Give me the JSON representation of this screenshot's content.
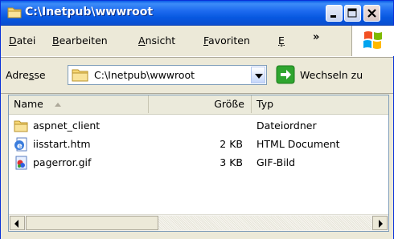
{
  "window": {
    "title": "C:\\Inetpub\\wwwroot",
    "controls": [
      "minimize",
      "maximize",
      "close"
    ]
  },
  "menu": {
    "items": [
      {
        "label": "Datei",
        "mnemonic": "D",
        "rest": "atei"
      },
      {
        "label": "Bearbeiten",
        "mnemonic": "B",
        "rest": "earbeiten"
      },
      {
        "label": "Ansicht",
        "mnemonic": "A",
        "rest": "nsicht"
      },
      {
        "label": "Favoriten",
        "mnemonic": "F",
        "rest": "avoriten"
      },
      {
        "label": "Ex",
        "mnemonic": "E",
        "rest": "̥"
      }
    ],
    "overflow": "»"
  },
  "address": {
    "label_pre": "Adre",
    "label_mn": "s",
    "label_post": "se",
    "value": "C:\\Inetpub\\wwwroot",
    "go_label": "Wechseln zu"
  },
  "list": {
    "columns": {
      "name": "Name",
      "size": "Größe",
      "type": "Typ"
    },
    "rows": [
      {
        "name": "aspnet_client",
        "size": "",
        "type": "Dateiordner",
        "icon": "folder-icon"
      },
      {
        "name": "iisstart.htm",
        "size": "2 KB",
        "type": "HTML Document",
        "icon": "html-document-icon"
      },
      {
        "name": "pagerror.gif",
        "size": "3 KB",
        "type": "GIF-Bild",
        "icon": "gif-image-icon"
      }
    ]
  },
  "colors": {
    "titlebar": "#0A5CE8",
    "chrome": "#ECE9D8",
    "border": "#7F9DB9"
  }
}
